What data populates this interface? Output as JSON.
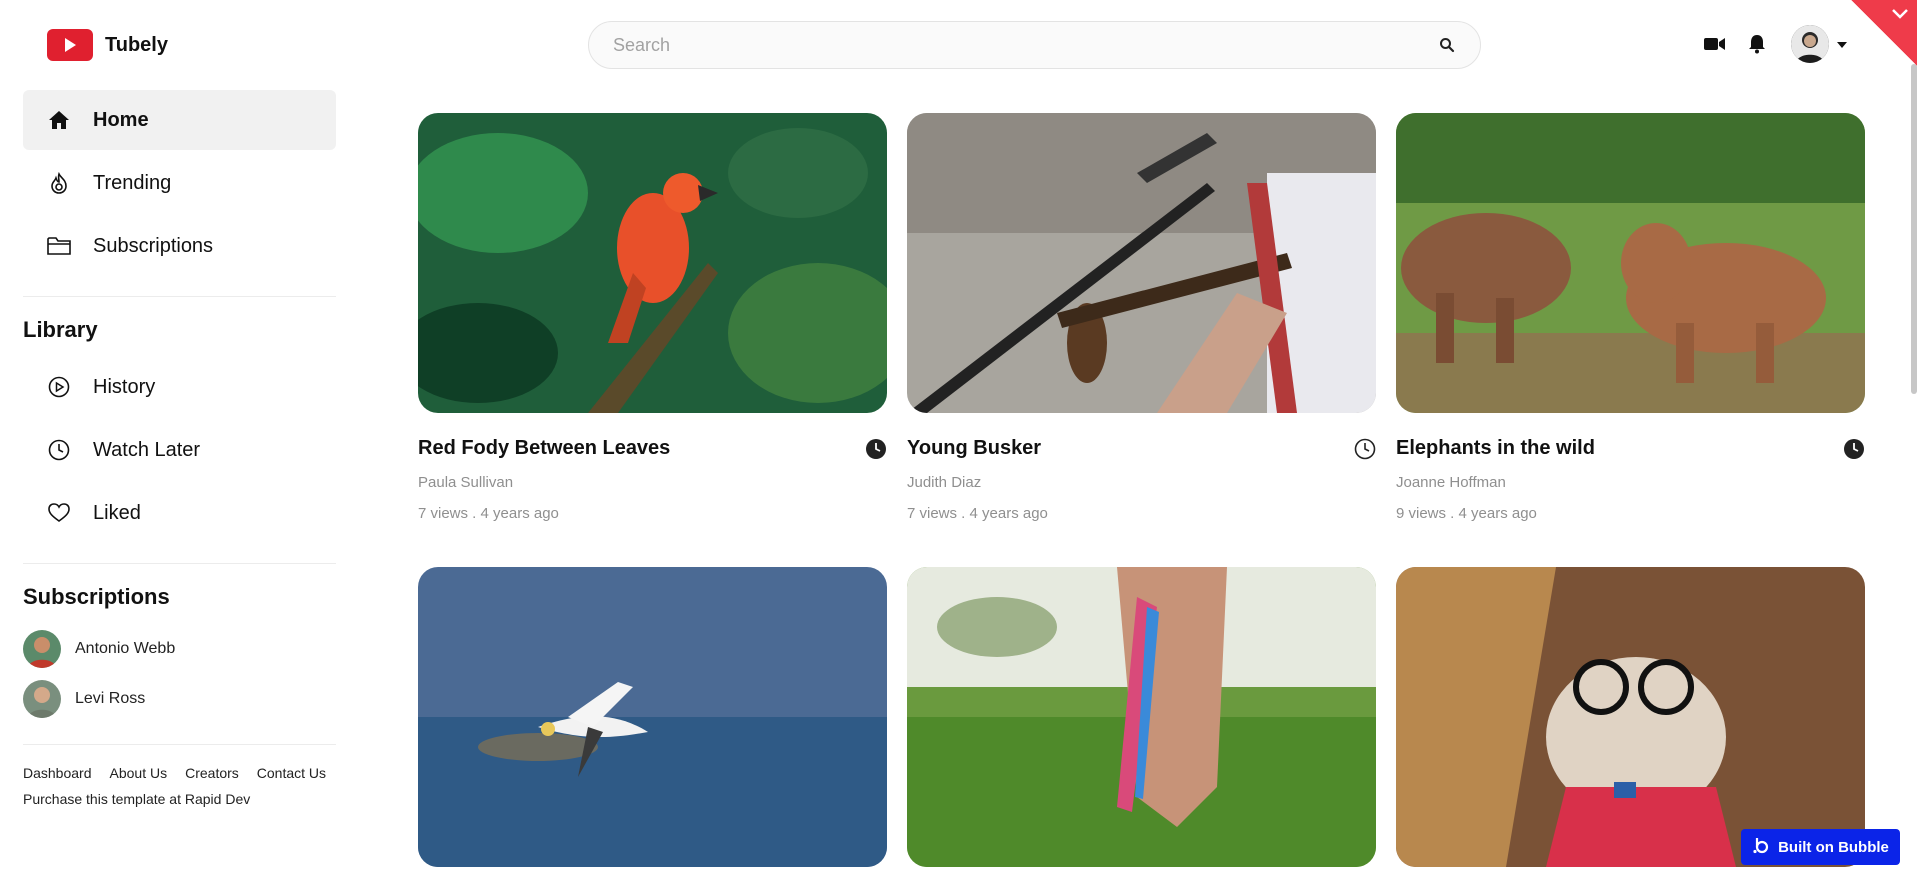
{
  "app": {
    "name": "Tubely"
  },
  "search": {
    "placeholder": "Search"
  },
  "sidebar": {
    "nav": [
      {
        "label": "Home",
        "icon": "home-icon",
        "active": true
      },
      {
        "label": "Trending",
        "icon": "trending-icon",
        "active": false
      },
      {
        "label": "Subscriptions",
        "icon": "folder-icon",
        "active": false
      }
    ],
    "library_title": "Library",
    "library": [
      {
        "label": "History",
        "icon": "history-icon"
      },
      {
        "label": "Watch Later",
        "icon": "clock-icon"
      },
      {
        "label": "Liked",
        "icon": "heart-icon"
      }
    ],
    "subscriptions_title": "Subscriptions",
    "subscriptions": [
      {
        "name": "Antonio Webb"
      },
      {
        "name": "Levi Ross"
      }
    ],
    "footer_links": [
      "Dashboard",
      "About Us",
      "Creators",
      "Contact Us"
    ],
    "purchase_text": "Purchase this template at Rapid Dev"
  },
  "videos": [
    {
      "title": "Red Fody Between Leaves",
      "author": "Paula Sullivan",
      "meta": "7 views . 4 years ago",
      "saved": true
    },
    {
      "title": "Young Busker",
      "author": "Judith Diaz",
      "meta": "7 views . 4 years ago",
      "saved": false
    },
    {
      "title": "Elephants in the wild",
      "author": "Joanne Hoffman",
      "meta": "9 views . 4 years ago",
      "saved": true
    },
    {
      "title": "",
      "author": "",
      "meta": "",
      "saved": false
    },
    {
      "title": "",
      "author": "",
      "meta": "",
      "saved": false
    },
    {
      "title": "",
      "author": "",
      "meta": "",
      "saved": false
    }
  ],
  "badge": {
    "label": "Built on Bubble"
  },
  "colors": {
    "brand": "#e0202f",
    "badge": "#0b24e8",
    "active_bg": "#f1f1f1",
    "muted_text": "#8f8f8f"
  }
}
